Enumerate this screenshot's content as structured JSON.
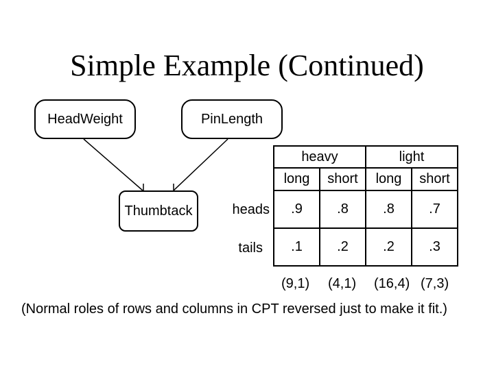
{
  "title": "Simple Example (Continued)",
  "network": {
    "nodes": [
      {
        "id": "HeadWeight",
        "label": "HeadWeight"
      },
      {
        "id": "PinLength",
        "label": "PinLength"
      },
      {
        "id": "Thumbtack",
        "label": "Thumbtack"
      }
    ],
    "edges": [
      {
        "from": "HeadWeight",
        "to": "Thumbtack"
      },
      {
        "from": "PinLength",
        "to": "Thumbtack"
      }
    ]
  },
  "cpt": {
    "group_headers": [
      "heavy",
      "light"
    ],
    "sub_headers": [
      "long",
      "short",
      "long",
      "short"
    ],
    "rows": [
      {
        "label": "heads",
        "values": [
          ".9",
          ".8",
          ".8",
          ".7"
        ]
      },
      {
        "label": "tails",
        "values": [
          ".1",
          ".2",
          ".2",
          ".3"
        ]
      }
    ],
    "counts": [
      "(9,1)",
      "(4,1)",
      "(16,4)",
      "(7,3)"
    ]
  },
  "note": "(Normal roles of rows and columns in CPT reversed just to make it fit.)"
}
